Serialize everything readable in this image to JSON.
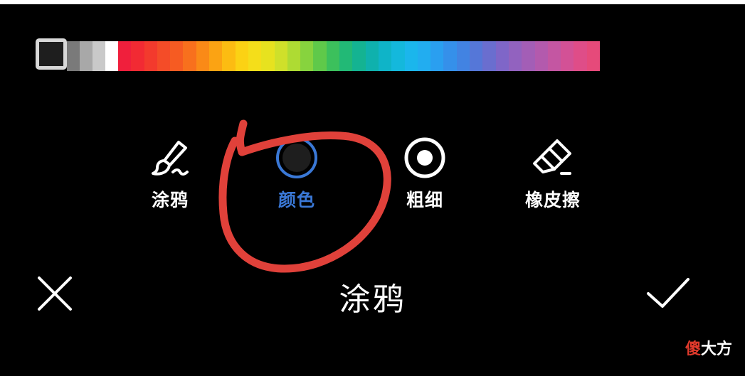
{
  "palette": {
    "selected_color": "#1e1e1e",
    "colors": [
      "#1e1e1e",
      "#7a7a7a",
      "#a8a8a8",
      "#c9c9c9",
      "#ffffff",
      "#f01f3c",
      "#f22a33",
      "#f33a2d",
      "#f44c28",
      "#f65b22",
      "#f8701d",
      "#fa8a17",
      "#fba313",
      "#fcbc12",
      "#fbd214",
      "#f4de1a",
      "#e7e21f",
      "#cfe02a",
      "#aedb33",
      "#87d33e",
      "#5fc94a",
      "#3cc05c",
      "#22b976",
      "#14b392",
      "#0fb1ad",
      "#0fb4c8",
      "#14b8dc",
      "#1bb6ec",
      "#22adf0",
      "#2a9ff0",
      "#3590ea",
      "#4283e2",
      "#5577d8",
      "#6a6ecf",
      "#7f66c8",
      "#9262bf",
      "#a35eb6",
      "#b35aad",
      "#c456a2",
      "#d35196",
      "#df4d88",
      "#e64a7a"
    ]
  },
  "tools": {
    "doodle": {
      "label": "涂鸦",
      "icon": "brush-icon"
    },
    "color": {
      "label": "颜色",
      "icon": "color-dot-icon",
      "active_color": "#3a78d6"
    },
    "size": {
      "label": "粗细",
      "icon": "stroke-size-icon"
    },
    "eraser": {
      "label": "橡皮擦",
      "icon": "eraser-icon"
    }
  },
  "bottom_bar": {
    "title": "涂鸦",
    "cancel_icon": "close-icon",
    "confirm_icon": "checkmark-icon"
  },
  "annotation": {
    "color": "#e0413a",
    "shape": "hand-drawn-circle"
  },
  "watermark": {
    "part1": "傻",
    "part2": "大方"
  }
}
